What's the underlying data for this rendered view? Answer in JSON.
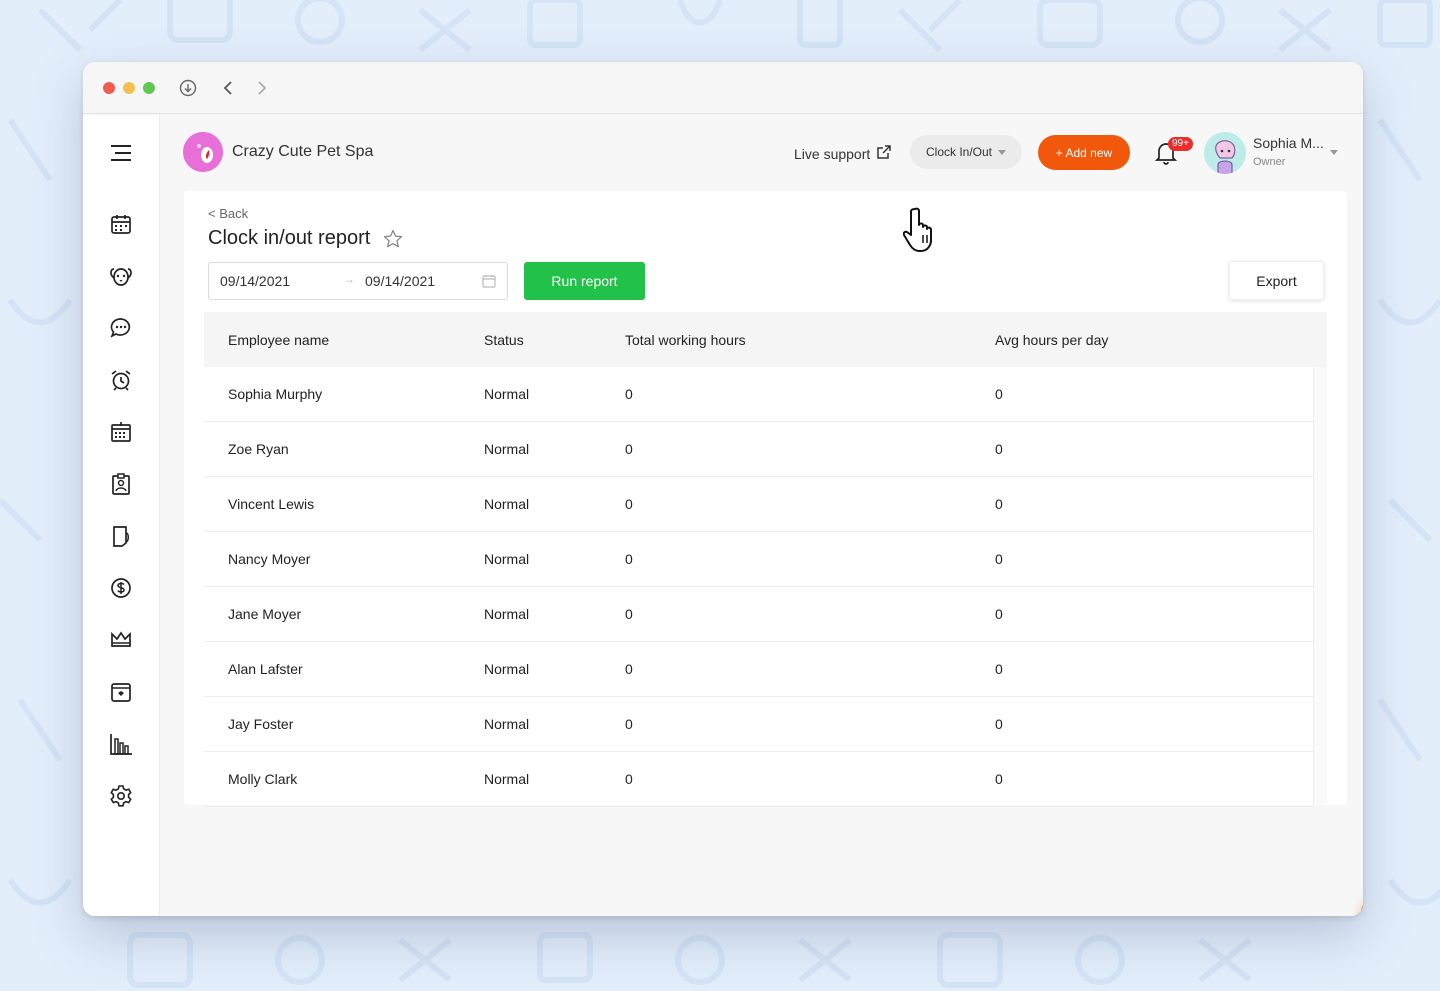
{
  "header": {
    "business_name": "Crazy Cute Pet Spa",
    "live_support_label": "Live support",
    "clock_button_label": "Clock In/Out",
    "add_new_label": "+ Add new",
    "notification_count": "99+",
    "user_name": "Sophia M...",
    "user_role": "Owner"
  },
  "report": {
    "back_label": "< Back",
    "title": "Clock in/out report",
    "date_from": "09/14/2021",
    "date_to": "09/14/2021",
    "run_label": "Run report",
    "export_label": "Export"
  },
  "table": {
    "headers": [
      "Employee name",
      "Status",
      "Total working hours",
      "Avg hours per day"
    ],
    "rows": [
      [
        "Sophia Murphy",
        "Normal",
        "0",
        "0"
      ],
      [
        "Zoe Ryan",
        "Normal",
        "0",
        "0"
      ],
      [
        "Vincent Lewis",
        "Normal",
        "0",
        "0"
      ],
      [
        "Nancy Moyer",
        "Normal",
        "0",
        "0"
      ],
      [
        "Jane Moyer",
        "Normal",
        "0",
        "0"
      ],
      [
        "Alan Lafster",
        "Normal",
        "0",
        "0"
      ],
      [
        "Jay Foster",
        "Normal",
        "0",
        "0"
      ],
      [
        "Molly Clark",
        "Normal",
        "0",
        "0"
      ]
    ]
  },
  "sidebar": {
    "icons": [
      "menu-icon",
      "calendar-icon",
      "pet-icon",
      "chat-icon",
      "alarm-clock-icon",
      "schedule-icon",
      "staff-badge-icon",
      "pet-report-icon",
      "dollar-icon",
      "crown-icon",
      "booking-icon",
      "analytics-icon",
      "settings-icon"
    ]
  },
  "colors": {
    "accent_orange": "#f2580c",
    "run_green": "#22c14a",
    "badge_red": "#ec2b2b",
    "background": "#e3eefb"
  }
}
